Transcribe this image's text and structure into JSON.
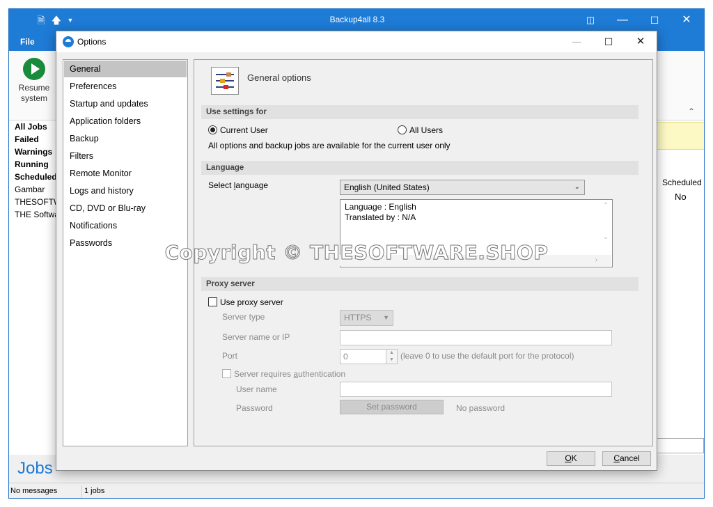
{
  "main_window": {
    "title": "Backup4all 8.3",
    "file_tab": "File",
    "resume_label": "Resume system",
    "job_categories": [
      "All Jobs",
      "Failed",
      "Warnings",
      "Running",
      "Scheduled",
      "Gambar",
      "THESOFTW",
      "THE Softwa"
    ],
    "column_header": "Scheduled",
    "column_value": "No",
    "jobs_title": "Jobs",
    "status_messages": "No messages",
    "status_jobs": "1 jobs",
    "accent_color": "#1e7bd6"
  },
  "dialog": {
    "title": "Options",
    "nav": [
      "General",
      "Preferences",
      "Startup and updates",
      "Application folders",
      "Backup",
      "Filters",
      "Remote Monitor",
      "Logs and history",
      "CD, DVD or Blu-ray",
      "Notifications",
      "Passwords"
    ],
    "selected_nav": "General",
    "header": "General options",
    "use_settings": {
      "title": "Use settings for",
      "current_user": "Current User",
      "all_users": "All Users",
      "selected": "Current User",
      "note": "All options and backup jobs are available for the current user only"
    },
    "language": {
      "title": "Language",
      "select_label_pre": "Select ",
      "select_label_ul": "l",
      "select_label_post": "anguage",
      "selected": "English (United States)",
      "info_line1": "Language : English",
      "info_line2": "Translated by : N/A"
    },
    "proxy": {
      "title": "Proxy server",
      "use_proxy": "Use proxy server",
      "use_proxy_checked": false,
      "server_type_label": "Server type",
      "server_type_value": "HTTPS",
      "server_name_label": "Server name or IP",
      "server_name_value": "",
      "port_label": "Port",
      "port_value": "0",
      "port_hint": "(leave 0 to use the default port for the protocol)",
      "auth_label_pre": "Server requires ",
      "auth_label_ul": "a",
      "auth_label_post": "uthentication",
      "auth_checked": false,
      "user_name_label": "User name",
      "user_name_value": "",
      "password_label": "Password",
      "set_password": "Set password",
      "no_password": "No password"
    },
    "ok_ul": "O",
    "ok_rest": "K",
    "cancel_ul": "C",
    "cancel_rest": "ancel"
  },
  "watermark": "Copyright © THESOFTWARE.SHOP"
}
